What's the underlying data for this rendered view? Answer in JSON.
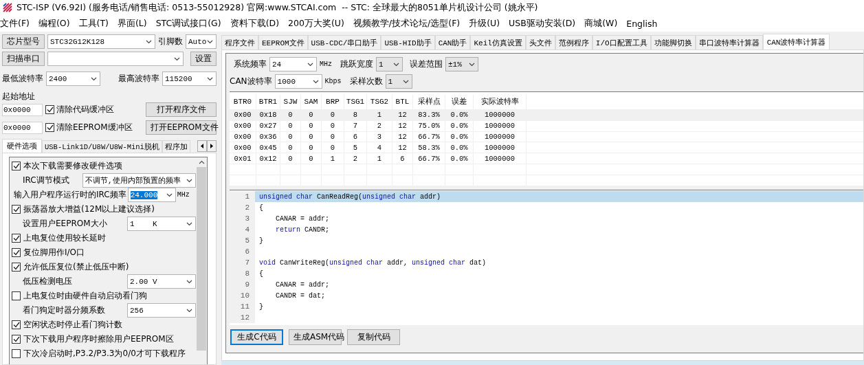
{
  "window": {
    "title": "STC-ISP (V6.92I) (服务电话/销售电话: 0513-55012928) 官网:www.STCAI.com  -- STC: 全球最大的8051单片机设计公司 (姚永平)"
  },
  "menu": [
    "文件(F)",
    "编程(O)",
    "工具(T)",
    "界面(L)",
    "STC调试接口(G)",
    "资料下载(D)",
    "200万大奖(U)",
    "视频教学/技术论坛/选型(F)",
    "升级(U)",
    "USB驱动安装(D)",
    "商城(W)",
    "English"
  ],
  "left": {
    "chip": {
      "button": "芯片型号",
      "value": "STC32G12K128",
      "pins_label": "引脚数",
      "pins_value": "Auto"
    },
    "port": {
      "button": "扫描串口",
      "settings_button": "设置"
    },
    "baud": {
      "min_label": "最低波特率",
      "min_value": "2400",
      "max_label": "最高波特率",
      "max_value": "115200"
    },
    "start_address": {
      "label": "起始地址",
      "rows": [
        {
          "value": "0x0000",
          "checkbox": "清除代码缓冲区",
          "checked": true,
          "button": "打开程序文件"
        },
        {
          "value": "0x0000",
          "checkbox": "清除EEPROM缓冲区",
          "checked": true,
          "button": "打开EEPROM文件"
        }
      ]
    },
    "tabs": [
      {
        "label": "硬件选项",
        "selected": true
      },
      {
        "label": "USB-Link1D/U8W/U8W-Mini脱机",
        "selected": false
      },
      {
        "label": "程序加",
        "selected": false
      }
    ],
    "options": [
      {
        "kind": "checkbox",
        "label": "本次下载需要修改硬件选项",
        "checked": true
      },
      {
        "kind": "select",
        "label": "IRC调节模式",
        "value": "不调节,使用内部预置的频率"
      },
      {
        "kind": "input",
        "label": "输入用户程序运行时的IRC频率",
        "value": "24.000",
        "unit": "MHz",
        "focused": true
      },
      {
        "kind": "checkbox",
        "label": "振荡器放大增益(12M以上建议选择)",
        "checked": true
      },
      {
        "kind": "select",
        "label": "设置用户EEPROM大小",
        "value": "1    K"
      },
      {
        "kind": "checkbox",
        "label": "上电复位使用较长延时",
        "checked": true
      },
      {
        "kind": "checkbox",
        "label": "复位脚用作I/O口",
        "checked": true
      },
      {
        "kind": "checkbox",
        "label": "允许低压复位(禁止低压中断)",
        "checked": true
      },
      {
        "kind": "select",
        "label": "低压检测电压",
        "value": "2.00 V"
      },
      {
        "kind": "checkbox",
        "label": "上电复位时由硬件自动启动看门狗",
        "checked": false
      },
      {
        "kind": "select",
        "label": "看门狗定时器分频系数",
        "value": "256"
      },
      {
        "kind": "checkbox",
        "label": "空闲状态时停止看门狗计数",
        "checked": true
      },
      {
        "kind": "checkbox",
        "label": "下次下载用户程序时擦除用户EEPROM区",
        "checked": true
      },
      {
        "kind": "checkbox",
        "label": "下次冷启动时,P3.2/P3.3为0/0才可下载程序",
        "checked": false
      }
    ]
  },
  "right": {
    "tabs": [
      {
        "label": "程序文件",
        "selected": false
      },
      {
        "label": "EEPROM文件",
        "selected": false
      },
      {
        "label": "USB-CDC/串口助手",
        "selected": false
      },
      {
        "label": "USB-HID助手",
        "selected": false
      },
      {
        "label": "CAN助手",
        "selected": false
      },
      {
        "label": "Keil仿真设置",
        "selected": false
      },
      {
        "label": "头文件",
        "selected": false
      },
      {
        "label": "范例程序",
        "selected": false
      },
      {
        "label": "I/O口配置工具",
        "selected": false
      },
      {
        "label": "功能脚切换",
        "selected": false
      },
      {
        "label": "串口波特率计算器",
        "selected": false
      },
      {
        "label": "CAN波特率计算器",
        "selected": true
      }
    ],
    "form": {
      "sys_freq_label": "系统频率",
      "sys_freq": "24",
      "sys_freq_unit": "MHz",
      "sjw_label": "跳跃宽度",
      "sjw": "1",
      "error_label": "误差范围",
      "error": "±1%",
      "can_baud_label": "CAN波特率",
      "can_baud": "1000",
      "can_baud_unit": "Kbps",
      "samples_label": "采样次数",
      "samples": "1"
    },
    "table": {
      "columns": [
        "BTR0",
        "BTR1",
        "SJW",
        "SAM",
        "BRP",
        "TSG1",
        "TSG2",
        "BTL",
        "采样点",
        "误差",
        "实际波特率"
      ],
      "rows": [
        {
          "selected": true,
          "cells": [
            "0x00",
            "0x18",
            "0",
            "0",
            "0",
            "8",
            "1",
            "12",
            "83.3%",
            "0.0%",
            "1000000"
          ]
        },
        {
          "selected": false,
          "cells": [
            "0x00",
            "0x27",
            "0",
            "0",
            "0",
            "7",
            "2",
            "12",
            "75.0%",
            "0.0%",
            "1000000"
          ]
        },
        {
          "selected": false,
          "cells": [
            "0x00",
            "0x36",
            "0",
            "0",
            "0",
            "6",
            "3",
            "12",
            "66.7%",
            "0.0%",
            "1000000"
          ]
        },
        {
          "selected": false,
          "cells": [
            "0x00",
            "0x45",
            "0",
            "0",
            "0",
            "5",
            "4",
            "12",
            "58.3%",
            "0.0%",
            "1000000"
          ]
        },
        {
          "selected": false,
          "cells": [
            "0x01",
            "0x12",
            "0",
            "0",
            "1",
            "2",
            "1",
            "6",
            "66.7%",
            "0.0%",
            "1000000"
          ]
        }
      ]
    },
    "code": [
      {
        "number": "1",
        "highlighted": true,
        "tokens": [
          {
            "kind": "keyword",
            "text": "unsigned char"
          },
          {
            "kind": "plain",
            "text": " CanReadReg("
          },
          {
            "kind": "keyword",
            "text": "unsigned char"
          },
          {
            "kind": "plain",
            "text": " addr)"
          }
        ]
      },
      {
        "number": "2",
        "highlighted": false,
        "tokens": [
          {
            "kind": "plain",
            "text": "{"
          }
        ]
      },
      {
        "number": "3",
        "highlighted": false,
        "tokens": [
          {
            "kind": "plain",
            "text": "    CANAR = addr;"
          }
        ]
      },
      {
        "number": "4",
        "highlighted": false,
        "tokens": [
          {
            "kind": "keyword",
            "text": "    return"
          },
          {
            "kind": "plain",
            "text": " CANDR;"
          }
        ]
      },
      {
        "number": "5",
        "highlighted": false,
        "tokens": [
          {
            "kind": "plain",
            "text": "}"
          }
        ]
      },
      {
        "number": "6",
        "highlighted": false
      },
      {
        "number": "7",
        "highlighted": false,
        "tokens": [
          {
            "kind": "keyword",
            "text": "void"
          },
          {
            "kind": "plain",
            "text": " CanWriteReg("
          },
          {
            "kind": "keyword",
            "text": "unsigned char"
          },
          {
            "kind": "plain",
            "text": " addr, "
          },
          {
            "kind": "keyword",
            "text": "unsigned char"
          },
          {
            "kind": "plain",
            "text": " dat)"
          }
        ]
      },
      {
        "number": "8",
        "highlighted": false,
        "tokens": [
          {
            "kind": "plain",
            "text": "{"
          }
        ]
      },
      {
        "number": "9",
        "highlighted": false,
        "tokens": [
          {
            "kind": "plain",
            "text": "    CANAR = addr;"
          }
        ]
      },
      {
        "number": "10",
        "highlighted": false,
        "tokens": [
          {
            "kind": "plain",
            "text": "    CANDR = dat;"
          }
        ]
      },
      {
        "number": "11",
        "highlighted": false,
        "tokens": [
          {
            "kind": "plain",
            "text": "}"
          }
        ]
      },
      {
        "number": "12",
        "highlighted": false
      }
    ],
    "buttons": [
      {
        "label": "生成C代码",
        "focused": true
      },
      {
        "label": "生成ASM代码",
        "focused": false
      },
      {
        "label": "复制代码",
        "focused": false
      }
    ]
  }
}
